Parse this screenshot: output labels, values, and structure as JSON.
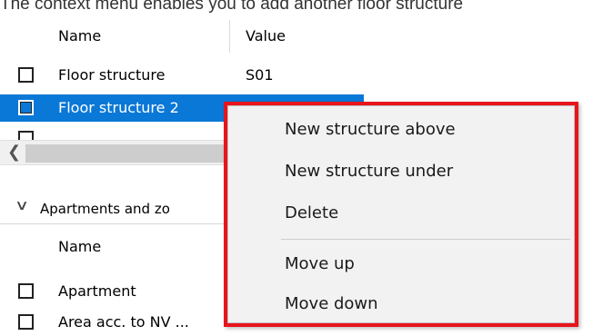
{
  "caption": "The context menu enables you to add another floor structure",
  "structures_table": {
    "columns": [
      "Name",
      "Value"
    ],
    "rows": [
      {
        "name": "Floor structure",
        "value": "S01",
        "selected": false
      },
      {
        "name": "Floor structure 2",
        "value": "",
        "selected": true
      }
    ]
  },
  "group": {
    "label": "Apartments and zo"
  },
  "apartments_table": {
    "columns": [
      "Name"
    ],
    "rows": [
      {
        "name": "Apartment"
      },
      {
        "name": "Area acc. to NV ..."
      }
    ]
  },
  "context_menu": {
    "items": [
      "New structure above",
      "New structure under",
      "Delete",
      "Move up",
      "Move down"
    ],
    "highlight_color": "#e8141c"
  },
  "colors": {
    "selection": "#0a78d7"
  }
}
